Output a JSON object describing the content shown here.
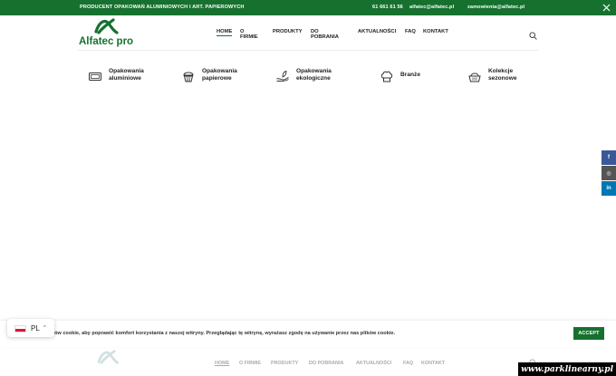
{
  "topbar": {
    "tagline": "PRODUCENT OPAKOWAŃ ALUMINIOWYCH I ART. PAPIEROWYCH",
    "phone": "61 661 61 56",
    "email1": "alfatec@alfatec.pl",
    "email2": "zamowienia@alfatec.pl",
    "close_icon": "close-icon"
  },
  "header": {
    "logo_text": "Alfatec pro",
    "nav": [
      "HOME",
      "O FIRMIE",
      "PRODUKTY",
      "DO POBRANIA",
      "AKTUALNOŚCI",
      "FAQ",
      "KONTAKT"
    ],
    "active_nav": "HOME",
    "search_icon": "search-icon"
  },
  "categories": [
    {
      "line1": "Opakowania",
      "line2": "aluminiowe",
      "icon": "tray-icon"
    },
    {
      "line1": "Opakowania",
      "line2": "papierowe",
      "icon": "cupcake-icon"
    },
    {
      "line1": "Opakowania",
      "line2": "ekologiczne",
      "icon": "eco-hand-icon"
    },
    {
      "line1": "Branże",
      "line2": "",
      "icon": "chef-hat-icon"
    },
    {
      "line1": "Kolekcje",
      "line2": "sezonowe",
      "icon": "basket-icon"
    }
  ],
  "social": [
    {
      "label": "f",
      "icon": "facebook-icon"
    },
    {
      "label": "◎",
      "icon": "instagram-icon"
    },
    {
      "label": "in",
      "icon": "linkedin-icon"
    }
  ],
  "cookie": {
    "text": "ów cookie, aby poprawić komfort korzystania z naszej witryny. Przeglądając tę witrynę, wyrażasz zgodę na używanie przez nas plików cookie.",
    "accept_label": "ACCEPT"
  },
  "language": {
    "code": "PL",
    "caret": "^"
  },
  "watermark": "www.parklinearny.pl",
  "colors": {
    "brand_green": "#16712f"
  }
}
